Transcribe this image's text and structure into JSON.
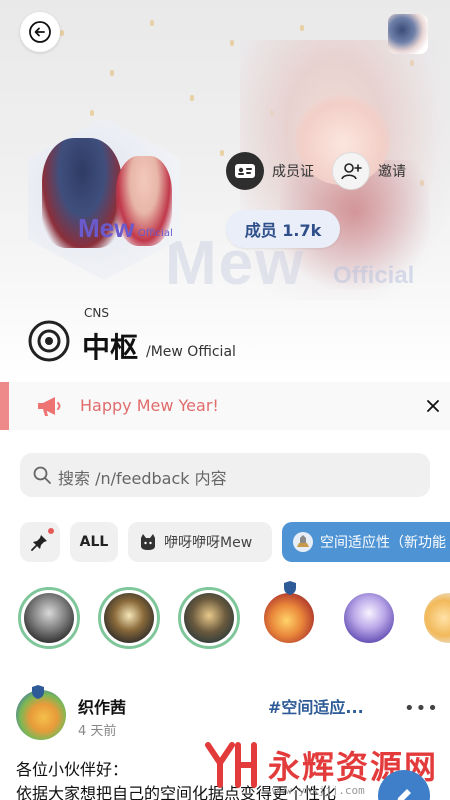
{
  "header": {
    "back_icon": "back-arrow-icon",
    "membership_card_label": "成员证",
    "invite_label": "邀请",
    "member_count_label": "成员 1.7k",
    "cover_watermark": "Mew",
    "cover_watermark_sub": "Official",
    "hex_logo_text": "Mew",
    "hex_logo_sub": "Official"
  },
  "community": {
    "code": "CNS",
    "name": "中枢",
    "subtitle": "/Mew Official"
  },
  "announcement": {
    "text": "Happy Mew Year!",
    "accent_color": "#ee8a8a",
    "text_color": "#e06c6c"
  },
  "search": {
    "placeholder": "搜索 /n/feedback 内容"
  },
  "filters": {
    "all_label": "ALL",
    "category_label": "咿呀咿呀Mew",
    "active_label": "空间适应性（新功能",
    "active_color": "#4e93d4"
  },
  "post": {
    "author": "织作茜",
    "time": "4 天前",
    "tag": "#空间适应...",
    "more": "•••",
    "body_line1": "各位小伙伴好：",
    "body_line2": "依据大家想把自己的空间化据点变得更个性化"
  },
  "watermark": {
    "brand_cn": "永辉资源网",
    "brand_url": "www.yhkjjj.com"
  }
}
